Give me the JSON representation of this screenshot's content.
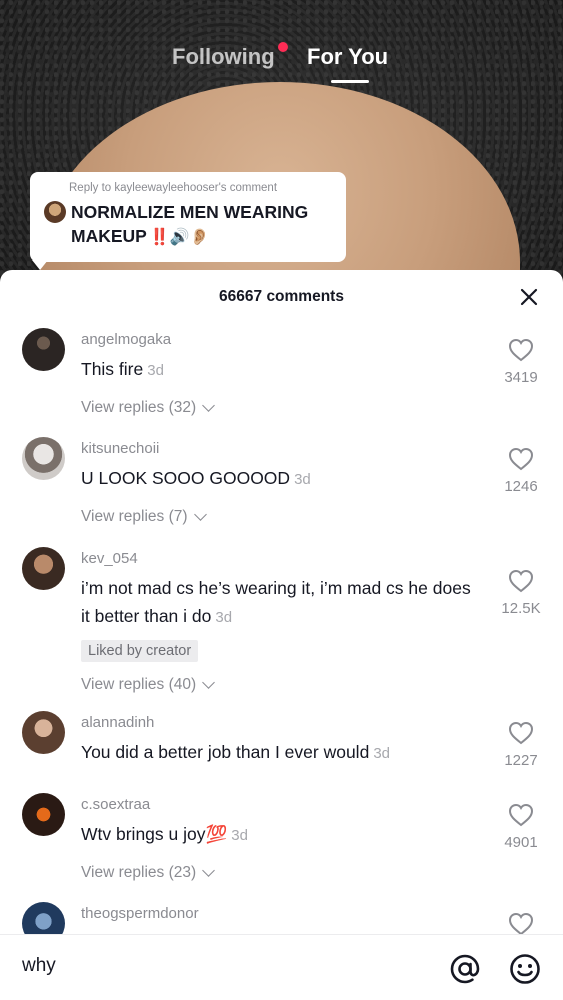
{
  "nav": {
    "following": "Following",
    "for_you": "For You"
  },
  "reply_card": {
    "label": "Reply to kayleewayleehooser's comment",
    "text_line1": "NORMALIZE MEN WEARING",
    "text_line2": "MAKEUP",
    "emoji": "‼️🔊👂🏼"
  },
  "comments_header": {
    "count_label": "66667 comments"
  },
  "comments": [
    {
      "username": "angelmogaka",
      "text": "This fire",
      "time": "3d",
      "likes": "3419",
      "replies": "View replies (32)"
    },
    {
      "username": "kitsunechoii",
      "text": "U LOOK SOOO GOOOOD",
      "time": "3d",
      "likes": "1246",
      "replies": "View replies (7)"
    },
    {
      "username": "kev_054",
      "text": "i’m not mad cs he’s wearing it, i’m mad cs he does it better than i do",
      "time": "3d",
      "likes": "12.5K",
      "badge": "Liked by creator",
      "replies": "View replies (40)"
    },
    {
      "username": "alannadinh",
      "text": "You did a better job than I ever would",
      "time": "3d",
      "likes": "1227"
    },
    {
      "username": "c.soextraa",
      "text": "Wtv brings u joy💯",
      "time": "3d",
      "likes": "4901",
      "replies": "View replies (23)"
    },
    {
      "username": "theogspermdonor",
      "text": "",
      "time": "",
      "likes": ""
    }
  ],
  "input": {
    "value": "why"
  },
  "icons": {
    "close": "close-icon",
    "heart": "heart-outline-icon",
    "mention": "at-icon",
    "emoji": "emoji-icon"
  },
  "colors": {
    "accent_red": "#fe2c55",
    "text_primary": "#161823",
    "text_secondary": "#8a8b91"
  }
}
